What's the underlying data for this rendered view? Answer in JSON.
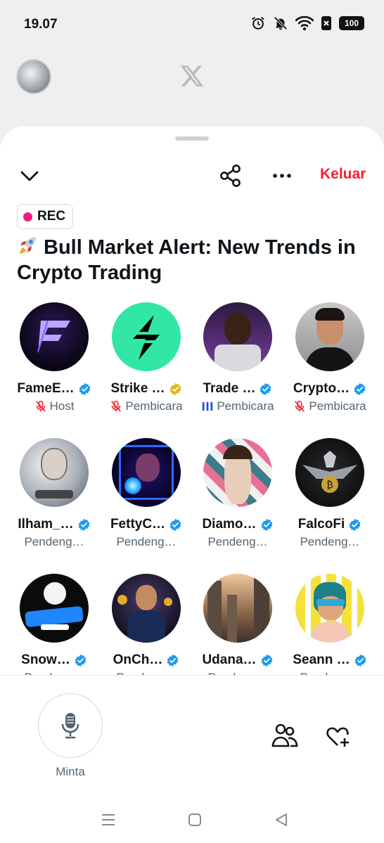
{
  "status_bar": {
    "time": "19.07",
    "battery": "100"
  },
  "sheet": {
    "exit_label": "Keluar",
    "rec_label": "REC",
    "title": "Bull Market Alert: New Trends in Crypto Trading"
  },
  "participants": [
    {
      "name": "FameE…",
      "role": "Host",
      "role_icon": "muted-mic-icon",
      "badge": "blue",
      "avatar": "logo-f"
    },
    {
      "name": "Strike …",
      "role": "Pembicara",
      "role_icon": "muted-mic-icon",
      "badge": "gold",
      "avatar": "strike"
    },
    {
      "name": "Trade …",
      "role": "Pembicara",
      "role_icon": "speaking-bars-icon",
      "badge": "blue",
      "avatar": "trade"
    },
    {
      "name": "Crypto…",
      "role": "Pembicara",
      "role_icon": "muted-mic-icon",
      "badge": "blue",
      "avatar": "crypto"
    },
    {
      "name": "Ilham_…",
      "role": "Pendeng…",
      "role_icon": "",
      "badge": "blue",
      "avatar": "ilham"
    },
    {
      "name": "FettyC…",
      "role": "Pendeng…",
      "role_icon": "",
      "badge": "blue",
      "avatar": "fetty"
    },
    {
      "name": "Diamo…",
      "role": "Pendeng…",
      "role_icon": "",
      "badge": "blue",
      "avatar": "diamond"
    },
    {
      "name": "FalcoFi",
      "role": "Pendeng…",
      "role_icon": "",
      "badge": "blue",
      "avatar": "falco"
    },
    {
      "name": "Snow…",
      "role": "Pendeng…",
      "role_icon": "",
      "badge": "blue",
      "avatar": "snowman"
    },
    {
      "name": "OnCh…",
      "role": "Pendeng…",
      "role_icon": "",
      "badge": "blue",
      "avatar": "onch"
    },
    {
      "name": "Udana…",
      "role": "Pendeng…",
      "role_icon": "",
      "badge": "blue",
      "avatar": "udana"
    },
    {
      "name": "Seann …",
      "role": "Pendeng…",
      "role_icon": "",
      "badge": "blue",
      "avatar": "seann"
    }
  ],
  "bottom": {
    "request_label": "Minta"
  },
  "colors": {
    "accent_red": "#f4212e",
    "rec_dot": "#f91880",
    "verified_blue": "#1d9bf0",
    "verified_gold": "#e2b719",
    "speaking": "#1d4ed8"
  }
}
